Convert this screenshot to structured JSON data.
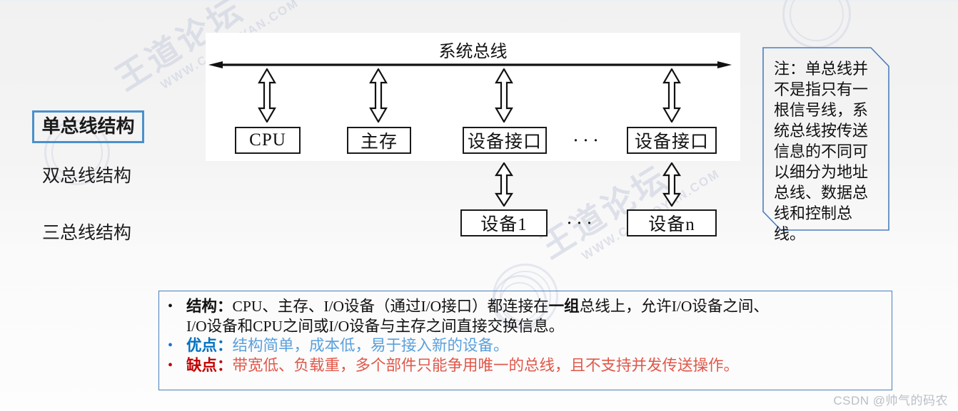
{
  "watermark": {
    "brand": "王道论坛",
    "url": "WWW.CSKAOYAN.COM"
  },
  "nav": {
    "selected_index": 0,
    "items": [
      {
        "label": "单总线结构",
        "selected": true
      },
      {
        "label": "双总线结构",
        "selected": false
      },
      {
        "label": "三总线结构",
        "selected": false
      }
    ],
    "selected_border_color": "#4a90cc"
  },
  "diagram": {
    "bus_label": "系统总线",
    "bus_arrow": "double-headed-horizontal",
    "top_row": [
      {
        "label": "CPU"
      },
      {
        "label": "主存"
      },
      {
        "label": "设备接口"
      },
      {
        "label": "···"
      },
      {
        "label": "设备接口"
      }
    ],
    "bottom_row": [
      {
        "label": "设备1"
      },
      {
        "label": "···"
      },
      {
        "label": "设备n"
      }
    ],
    "connector": "double-headed-vertical-arrow"
  },
  "note": {
    "text": "注：单总线并不是指只有一根信号线，系统总线按传送信息的不同可以细分为地址总线、数据总线和控制总线。",
    "border_color": "#4a7fbf"
  },
  "summary": {
    "border_color": "#4a7fbf",
    "lines": [
      {
        "bullet_color": "#111111",
        "lead": "结构：",
        "lead_color": "#111111",
        "text": "CPU、主存、I/O设备（通过I/O接口）都连接在",
        "emphasis": "一组",
        "text_after": "总线上，允许I/O设备之间、",
        "text_color": "#111111",
        "second_line": "I/O设备和CPU之间或I/O设备与主存之间直接交换信息。"
      },
      {
        "bullet_color": "#1f6fd0",
        "lead": "优点：",
        "lead_color": "#0070c0",
        "text": "结构简单，成本低，易于接入新的设备。",
        "text_color": "#5aa0dc"
      },
      {
        "bullet_color": "#c00000",
        "lead": "缺点：",
        "lead_color": "#c00000",
        "text": "带宽低、负载重，多个部件只能争用唯一的总线，且不支持并发传送操作。",
        "text_color": "#e0574a"
      }
    ]
  },
  "credit": "CSDN @帅气的码农"
}
